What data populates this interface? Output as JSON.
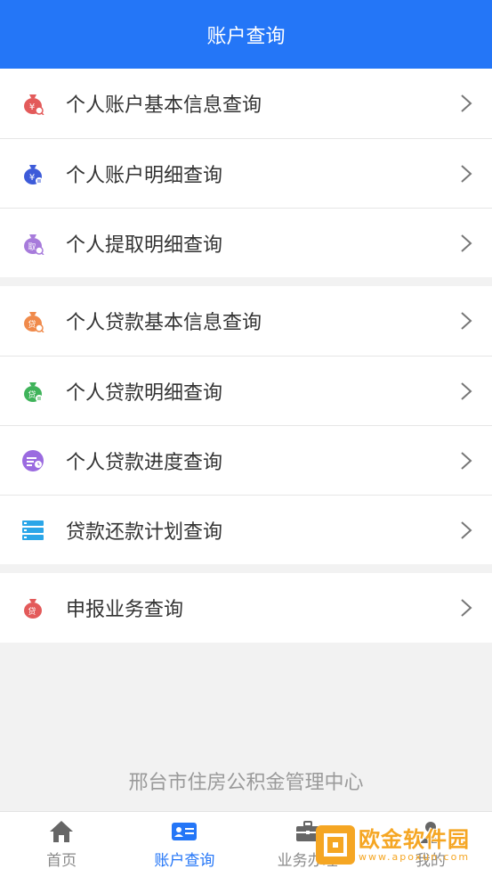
{
  "header": {
    "title": "账户查询"
  },
  "groups": [
    {
      "items": [
        {
          "label": "个人账户基本信息查询",
          "icon": "money-bag-search-icon",
          "color": "#e35a5a"
        },
        {
          "label": "个人账户明细查询",
          "icon": "money-bag-list-icon",
          "color": "#3d5bd9"
        },
        {
          "label": "个人提取明细查询",
          "icon": "withdraw-bag-search-icon",
          "color": "#a77bdb"
        }
      ]
    },
    {
      "items": [
        {
          "label": "个人贷款基本信息查询",
          "icon": "loan-bag-search-icon",
          "color": "#f08a4b"
        },
        {
          "label": "个人贷款明细查询",
          "icon": "loan-bag-list-icon",
          "color": "#3fb35a"
        },
        {
          "label": "个人贷款进度查询",
          "icon": "loan-progress-icon",
          "color": "#9b6be0"
        },
        {
          "label": "贷款还款计划查询",
          "icon": "repayment-plan-icon",
          "color": "#2ba6e8"
        }
      ]
    },
    {
      "items": [
        {
          "label": "申报业务查询",
          "icon": "declare-bag-icon",
          "color": "#e35a5a"
        }
      ]
    }
  ],
  "footer": {
    "text": "邢台市住房公积金管理中心"
  },
  "tabbar": {
    "tabs": [
      {
        "label": "首页",
        "icon": "home-icon",
        "active": false
      },
      {
        "label": "账户查询",
        "icon": "id-card-icon",
        "active": true
      },
      {
        "label": "业务办理",
        "icon": "briefcase-icon",
        "active": false
      },
      {
        "label": "我的",
        "icon": "user-icon",
        "active": false
      }
    ]
  },
  "watermark": {
    "name": "欧金软件园",
    "url": "www.apoxun.com"
  }
}
